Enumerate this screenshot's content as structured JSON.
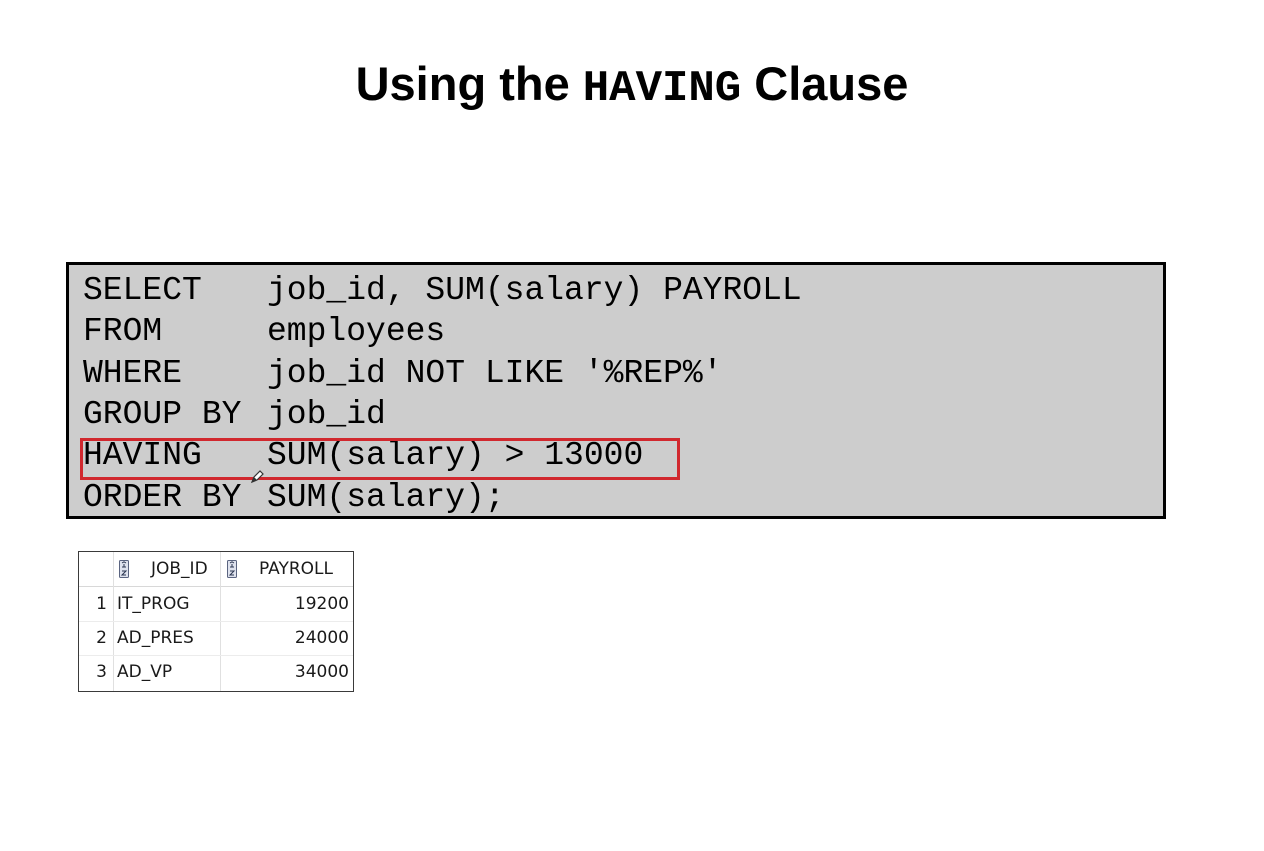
{
  "title": {
    "prefix": "Using the ",
    "keyword": "HAVING",
    "suffix": " Clause"
  },
  "code": {
    "lines": [
      {
        "clause": "SELECT",
        "body": "job_id, SUM(salary) PAYROLL"
      },
      {
        "clause": "FROM",
        "body": "employees"
      },
      {
        "clause": "WHERE",
        "body": "job_id NOT LIKE '%REP%'"
      },
      {
        "clause": "GROUP BY",
        "body": "job_id"
      },
      {
        "clause": "HAVING",
        "body": "SUM(salary) > 13000"
      },
      {
        "clause": "ORDER BY",
        "body": "SUM(salary);"
      }
    ],
    "highlight_color": "#d1282e",
    "background_color": "#cdcdcd"
  },
  "result": {
    "columns": [
      "JOB_ID",
      "PAYROLL"
    ],
    "rows": [
      {
        "num": "1",
        "job_id": "IT_PROG",
        "payroll": "19200"
      },
      {
        "num": "2",
        "job_id": "AD_PRES",
        "payroll": "24000"
      },
      {
        "num": "3",
        "job_id": "AD_VP",
        "payroll": "34000"
      }
    ],
    "column_icon": "sort-az-icon"
  }
}
